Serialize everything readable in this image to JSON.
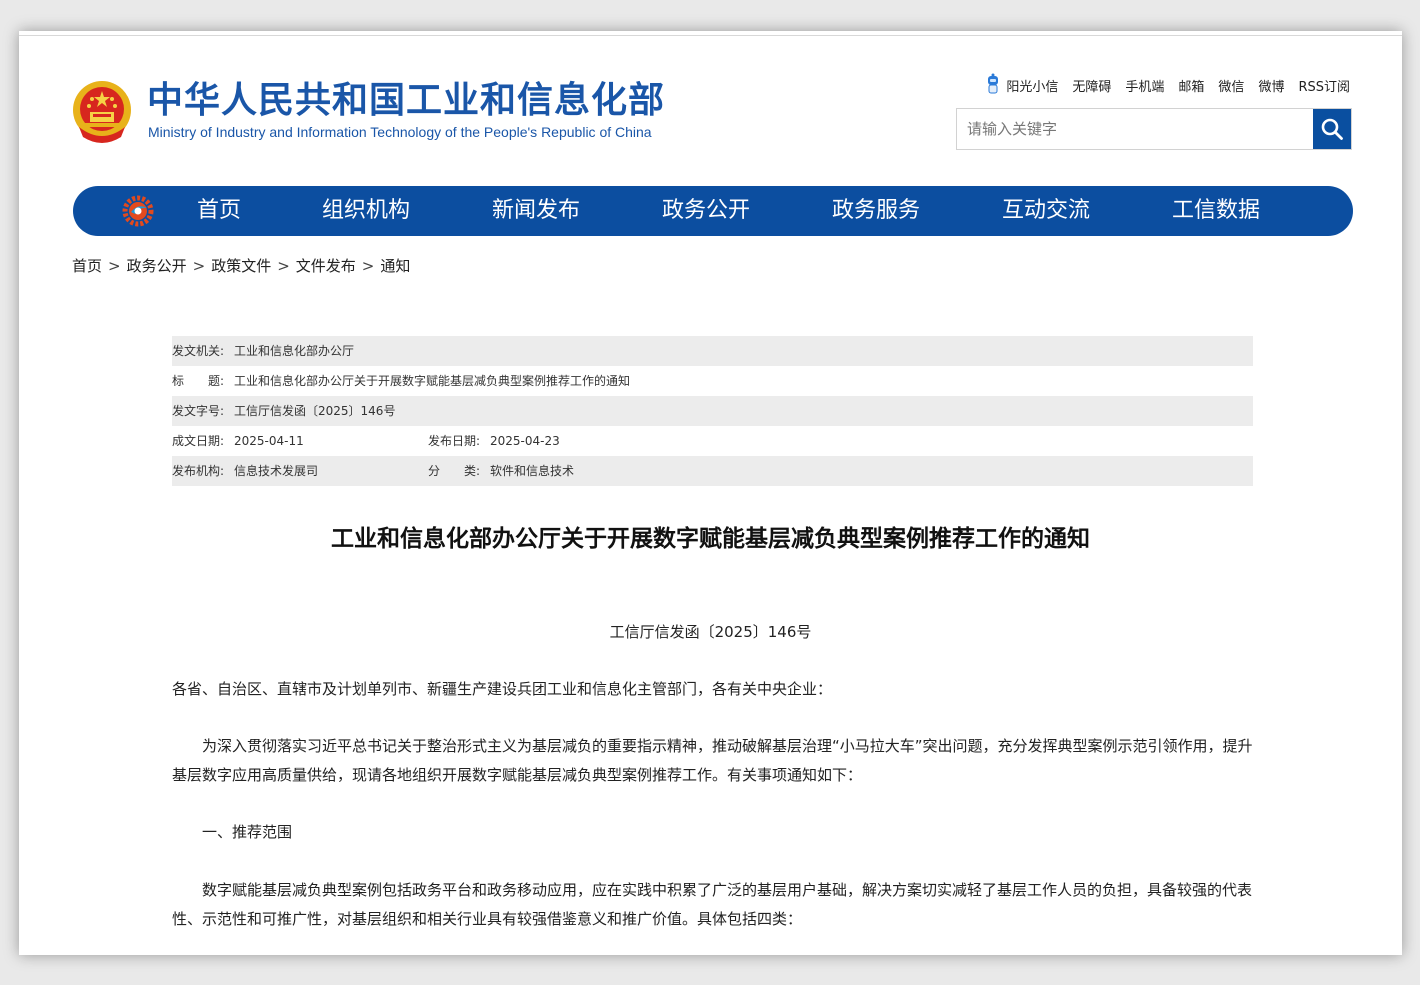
{
  "header": {
    "title": "中华人民共和国工业和信息化部",
    "subtitle": "Ministry of Industry and Information Technology of the People's Republic of China",
    "toplinks": [
      "阳光小信",
      "无障碍",
      "手机端",
      "邮箱",
      "微信",
      "微博",
      "RSS订阅"
    ],
    "search_placeholder": "请输入关键字"
  },
  "nav": {
    "items": [
      "首页",
      "组织机构",
      "新闻发布",
      "政务公开",
      "政务服务",
      "互动交流",
      "工信数据"
    ]
  },
  "breadcrumb": [
    "首页",
    "政务公开",
    "政策文件",
    "文件发布",
    "通知"
  ],
  "meta": {
    "issuer_label": "发文机关:",
    "issuer": "工业和信息化部办公厅",
    "title_label": "标　　题:",
    "title": "工业和信息化部办公厅关于开展数字赋能基层减负典型案例推荐工作的通知",
    "doc_no_label": "发文字号:",
    "doc_no": "工信厅信发函〔2025〕146号",
    "created_label": "成文日期:",
    "created": "2025-04-11",
    "published_label": "发布日期:",
    "published": "2025-04-23",
    "agency_label": "发布机构:",
    "agency": "信息技术发展司",
    "category_label": "分　　类:",
    "category": "软件和信息技术"
  },
  "article": {
    "title": "工业和信息化部办公厅关于开展数字赋能基层减负典型案例推荐工作的通知",
    "number": "工信厅信发函〔2025〕146号",
    "salutation": "各省、自治区、直辖市及计划单列市、新疆生产建设兵团工业和信息化主管部门，各有关中央企业：",
    "p1": "为深入贯彻落实习近平总书记关于整治形式主义为基层减负的重要指示精神，推动破解基层治理“小马拉大车”突出问题，充分发挥典型案例示范引领作用，提升基层数字应用高质量供给，现请各地组织开展数字赋能基层减负典型案例推荐工作。有关事项通知如下：",
    "section1": "一、推荐范围",
    "p2": "数字赋能基层减负典型案例包括政务平台和政务移动应用，应在实践中积累了广泛的基层用户基础，解决方案切实减轻了基层工作人员的负担，具备较强的代表性、示范性和可推广性，对基层组织和相关行业具有较强借鉴意义和推广价值。具体包括四类："
  },
  "colors": {
    "brand_blue": "#1a56a8",
    "nav_blue": "#0c4ea0",
    "meta_gray": "#ececec"
  }
}
